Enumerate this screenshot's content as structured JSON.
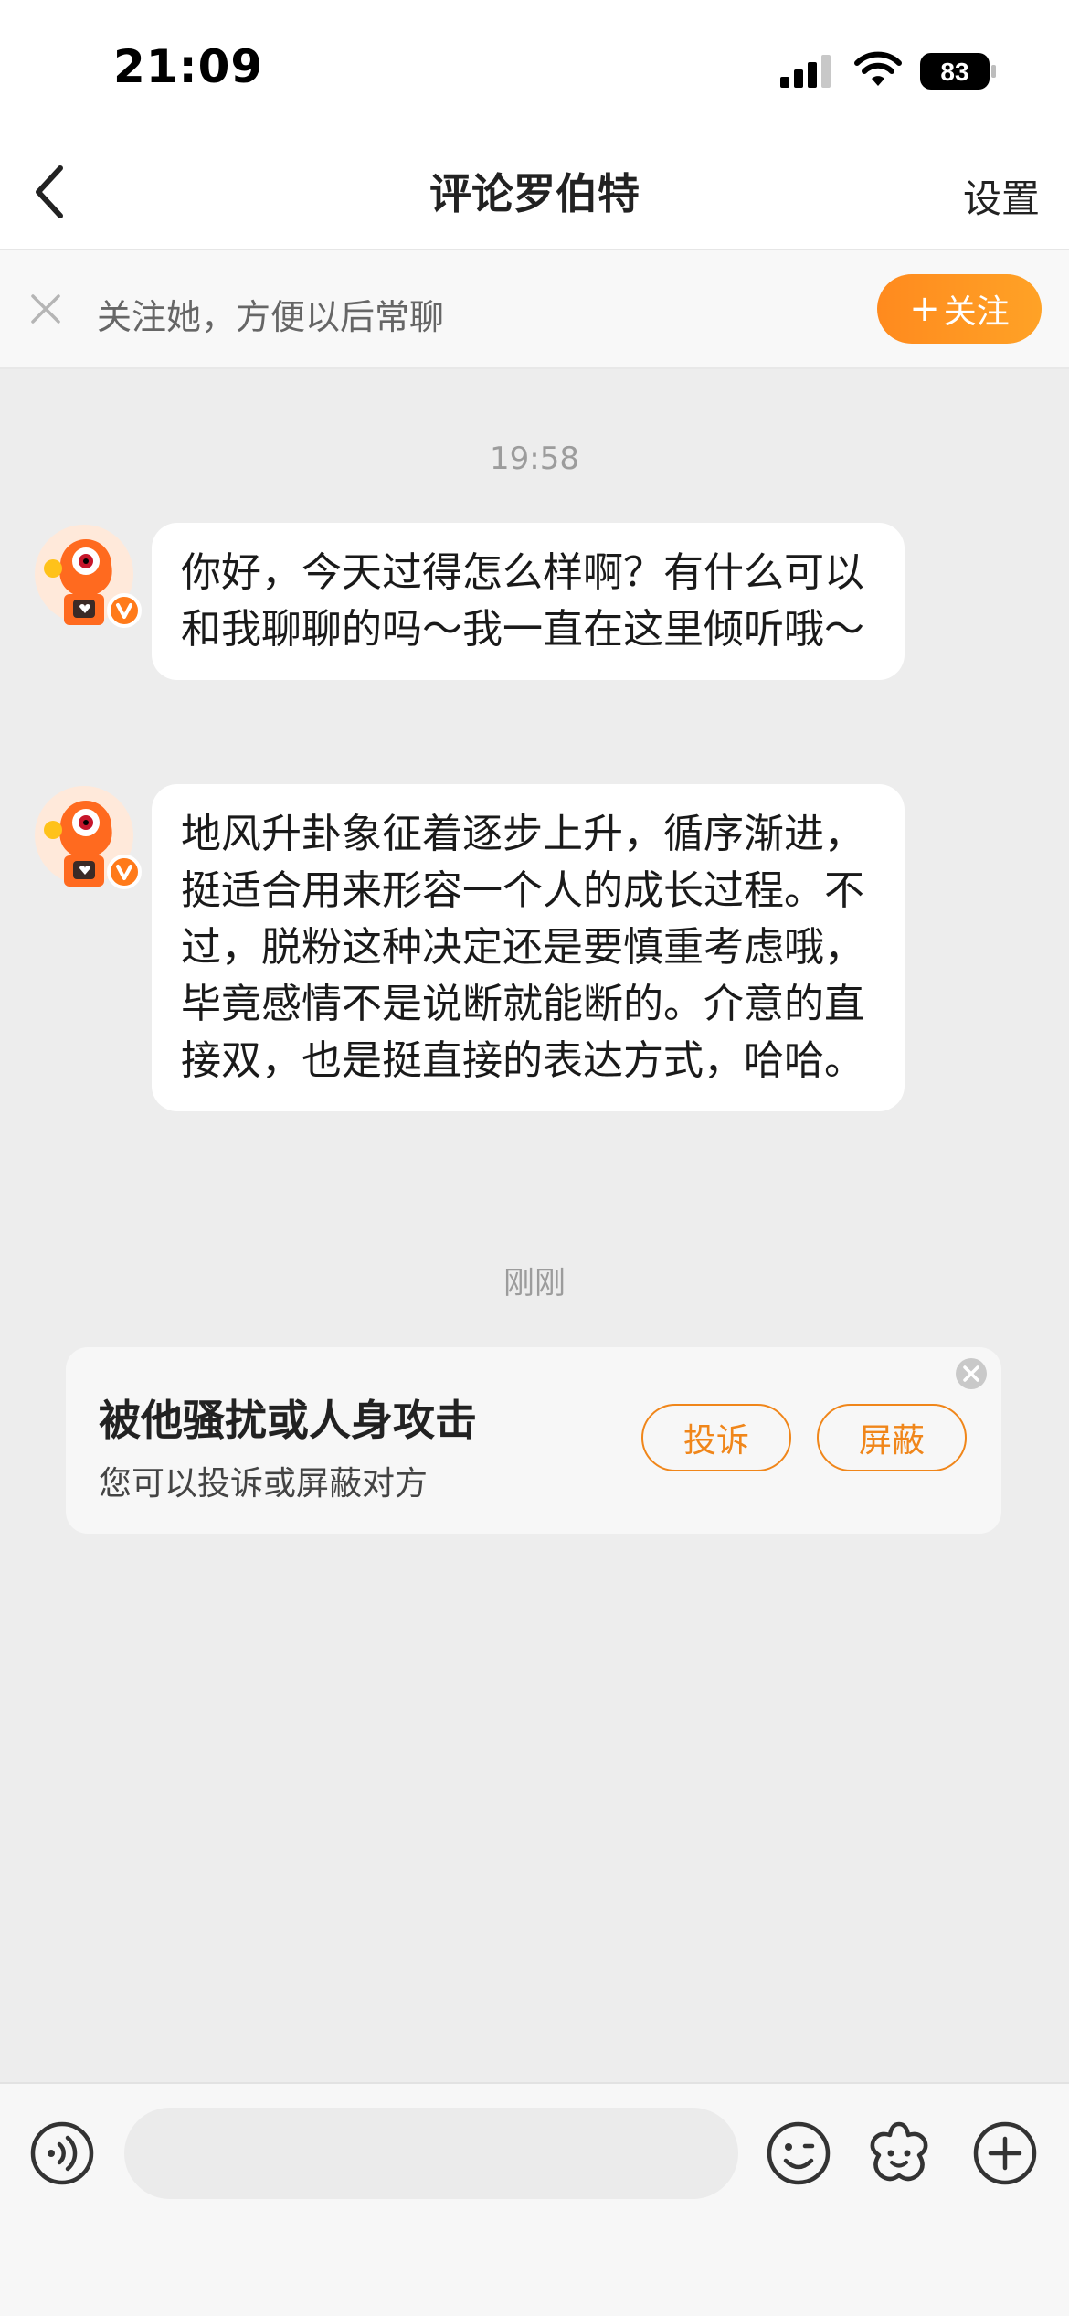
{
  "status_bar": {
    "time": "21:09",
    "battery": "83"
  },
  "nav": {
    "title": "评论罗伯特",
    "settings_label": "设置"
  },
  "follow_banner": {
    "text": "关注她，方便以后常聊",
    "follow_label": "关注"
  },
  "chat": {
    "timestamp_1": "19:58",
    "messages": [
      {
        "text": "你好，今天过得怎么样啊？有什么可以和我聊聊的吗～我一直在这里倾听哦～"
      },
      {
        "text": "地风升卦象征着逐步上升，循序渐进，挺适合用来形容一个人的成长过程。不过，脱粉这种决定还是要慎重考虑哦，毕竟感情不是说断就能断的。介意的直接双，也是挺直接的表达方式，哈哈。"
      }
    ],
    "timestamp_2": "刚刚"
  },
  "notice": {
    "title": "被他骚扰或人身攻击",
    "subtitle": "您可以投诉或屏蔽对方",
    "report_label": "投诉",
    "block_label": "屏蔽"
  },
  "colors": {
    "accent": "#FF8A1E",
    "background": "#EDEDED",
    "bubble": "#FFFFFF"
  },
  "icons": {
    "voice": "voice-icon",
    "emoji": "emoji-icon",
    "sticker": "sticker-icon",
    "add": "plus-icon"
  }
}
